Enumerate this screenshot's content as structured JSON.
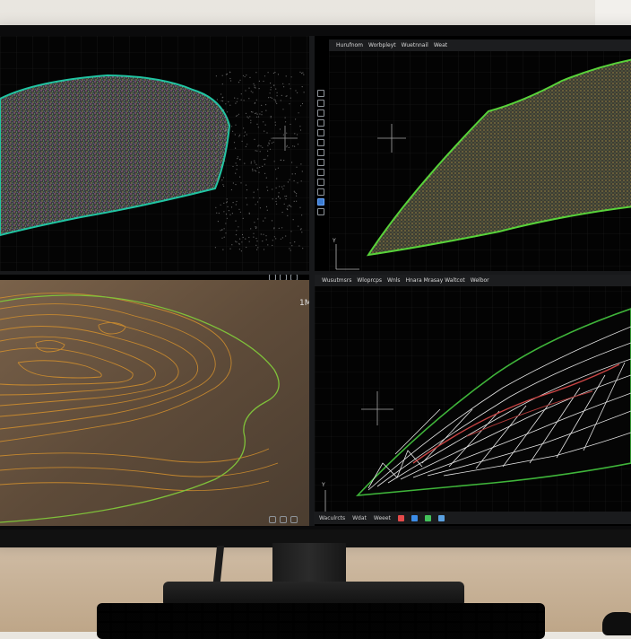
{
  "viewports": {
    "top_right": {
      "header_items": [
        "Hurufnom",
        "Worbpleyt",
        "Wuetnnail",
        "Weat"
      ]
    },
    "bottom_left": {
      "corner_label": "1M"
    },
    "bottom_right": {
      "header_items": [
        "Wusutmsrs",
        "Wloprcps",
        "Wnls",
        "Hnara Mrasay Waltcot",
        "Welbor"
      ]
    }
  },
  "status_bar": {
    "items": [
      "Waculrcts",
      "Wdat",
      "Weeet"
    ],
    "icon_colors": [
      "#e44a4a",
      "#3c8ce6",
      "#43c15a",
      "#5aa0e0"
    ]
  },
  "axes": {
    "x": "X",
    "y": "Y"
  },
  "colors": {
    "point_cloud_outline": "#21c4a2",
    "mesh_outline": "#58d23a",
    "contour_orange": "#d5912d",
    "contour_green": "#7fc13a",
    "breakline_red": "#c94444",
    "terrain_brown": "#6b5640"
  },
  "icons": [
    "crosshair-icon",
    "axis-gizmo-icon",
    "toolbar-icon"
  ]
}
